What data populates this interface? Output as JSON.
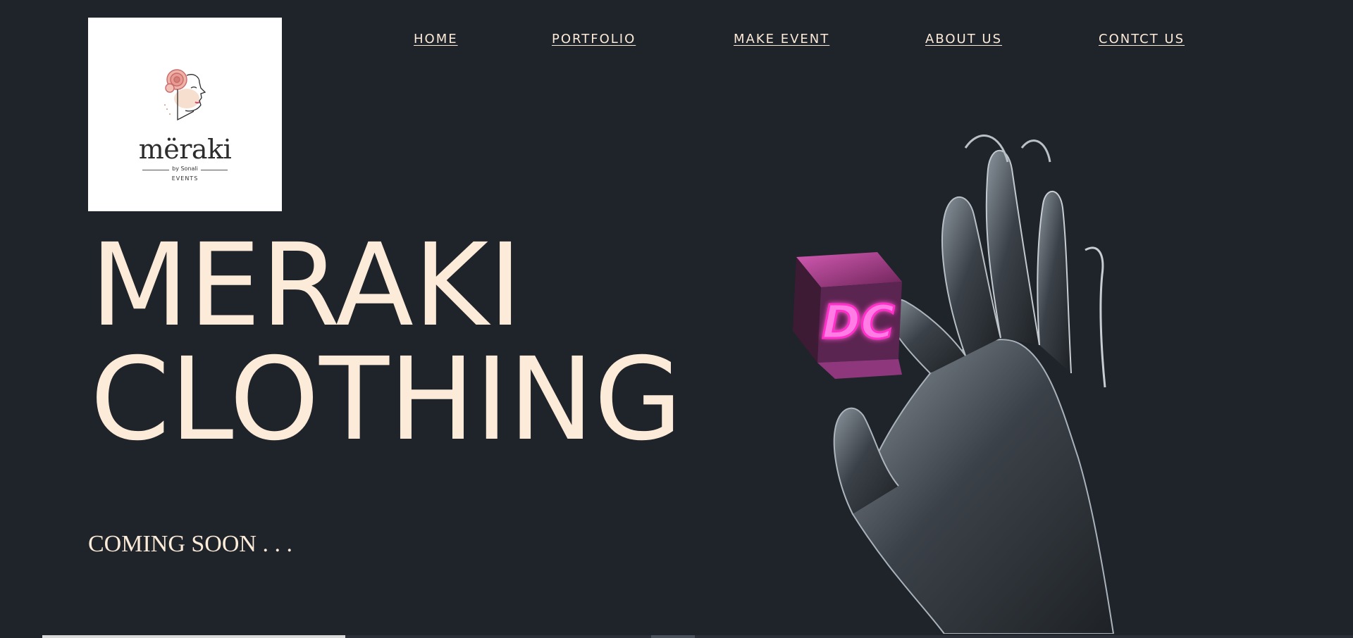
{
  "logo": {
    "wordmark": "mëraki",
    "byline": "by Sonali",
    "subtitle": "EVENTS",
    "icon": "woman-profile-flower-icon"
  },
  "nav": {
    "items": [
      {
        "label": "HOME"
      },
      {
        "label": "PORTFOLIO"
      },
      {
        "label": "MAKE EVENT"
      },
      {
        "label": "ABOUT US"
      },
      {
        "label": "CONTCT US"
      }
    ]
  },
  "hero": {
    "line1": "MERAKI",
    "line2": "CLOTHING",
    "tagline": "COMING SOON . . .",
    "cube_text": "DC",
    "image": "hand-holding-neon-cube"
  },
  "colors": {
    "background": "#1f232a",
    "text": "#fcebd8",
    "neon": "#ff4fd8"
  }
}
